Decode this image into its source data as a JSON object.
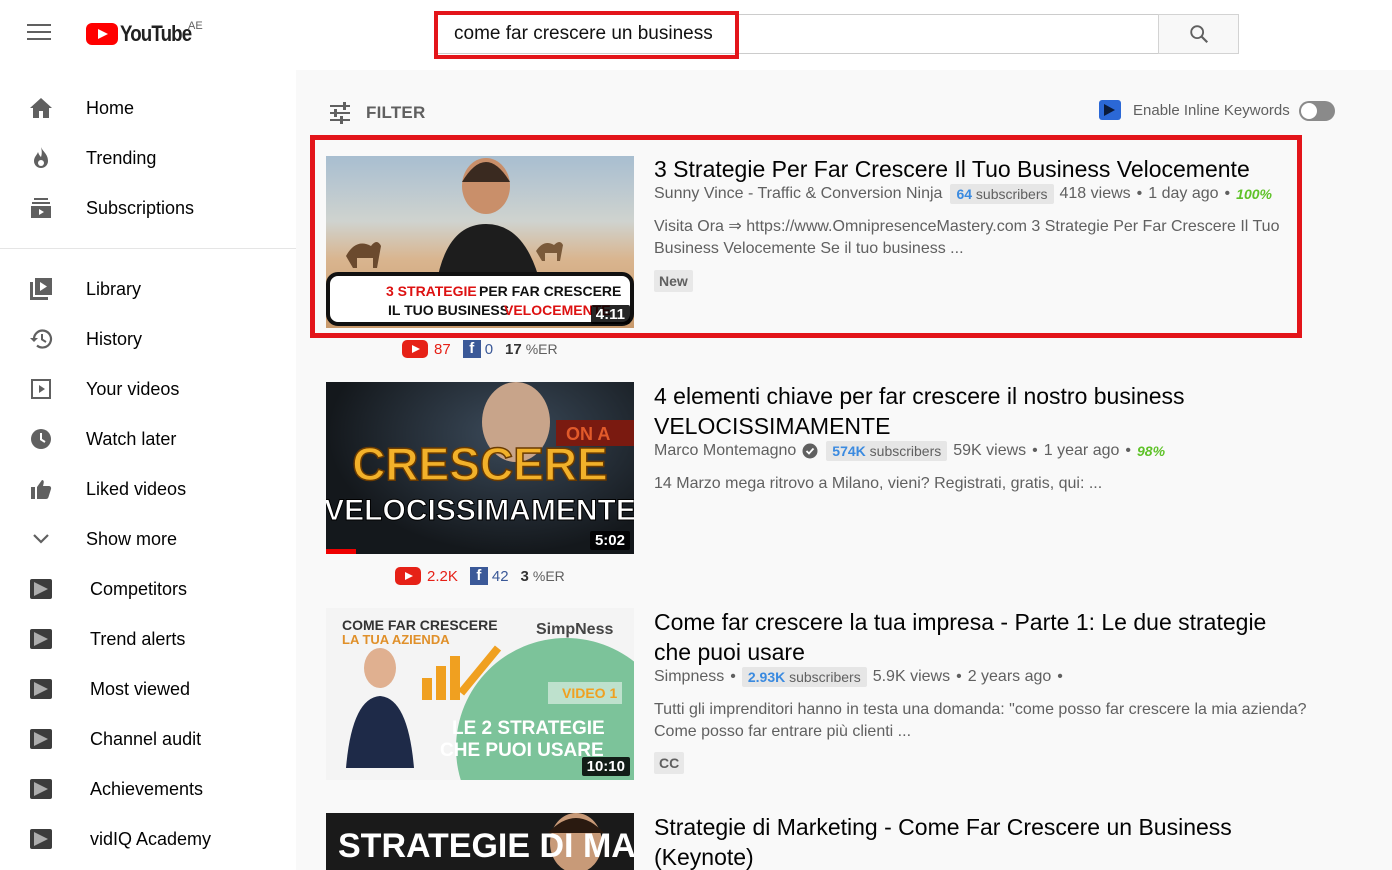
{
  "header": {
    "logo_text": "YouTube",
    "country": "AE",
    "search_value": "come far crescere un business"
  },
  "sidebar": {
    "main": [
      {
        "label": "Home",
        "icon": "home-icon"
      },
      {
        "label": "Trending",
        "icon": "trending-icon"
      },
      {
        "label": "Subscriptions",
        "icon": "subscriptions-icon"
      }
    ],
    "library": [
      {
        "label": "Library",
        "icon": "library-icon"
      },
      {
        "label": "History",
        "icon": "history-icon"
      },
      {
        "label": "Your videos",
        "icon": "your-videos-icon"
      },
      {
        "label": "Watch later",
        "icon": "watch-later-icon"
      },
      {
        "label": "Liked videos",
        "icon": "liked-videos-icon"
      },
      {
        "label": "Show more",
        "icon": "chevron-down-icon"
      }
    ],
    "vidiq": [
      {
        "label": "Competitors"
      },
      {
        "label": "Trend alerts"
      },
      {
        "label": "Most viewed"
      },
      {
        "label": "Channel audit"
      },
      {
        "label": "Achievements"
      },
      {
        "label": "vidIQ Academy"
      }
    ]
  },
  "toolbar": {
    "filter_label": "FILTER",
    "inline_keywords_label": "Enable Inline Keywords",
    "inline_keywords_enabled": false
  },
  "results": [
    {
      "title": "3 Strategie Per Far Crescere Il Tuo Business Velocemente",
      "channel": "Sunny Vince - Traffic & Conversion Ninja",
      "subs_count": "64",
      "subs_label": "subscribers",
      "views": "418 views",
      "age": "1 day ago",
      "score": "100%",
      "description": "Visita Ora ⇒ https://www.OmnipresenceMastery.com 3 Strategie Per Far Crescere Il Tuo Business Velocemente Se il tuo business ...",
      "badge": "New",
      "duration": "4:11",
      "thumb_line1a": "3 STRATEGIE",
      "thumb_line1b": " PER FAR CRESCERE",
      "thumb_line2a": "IL TUO BUSINESS ",
      "thumb_line2b": "VELOCEMENTE",
      "yt_count": "87",
      "fb_count": "0",
      "er": "17",
      "er_label": "%ER"
    },
    {
      "title": "4 elementi chiave per far crescere il nostro business VELOCISSIMAMENTE",
      "channel": "Marco Montemagno",
      "subs_count": "574K",
      "subs_label": "subscribers",
      "views": "59K views",
      "age": "1 year ago",
      "score": "98%",
      "description": "14 Marzo mega ritrovo a Milano, vieni? Registrati, gratis, qui: ...",
      "duration": "5:02",
      "thumb_word1": "CRESCERE",
      "thumb_word2": "VELOCISSIMAMENTE",
      "yt_count": "2.2K",
      "fb_count": "42",
      "er": "3",
      "er_label": "%ER"
    },
    {
      "title": "Come far crescere la tua impresa - Parte 1: Le due strategie che puoi usare",
      "channel": "Simpness",
      "subs_count": "2.93K",
      "subs_label": "subscribers",
      "views": "5.9K views",
      "age": "2 years ago",
      "description": "Tutti gli imprenditori hanno in testa una domanda: \"come posso far crescere la mia azienda? Come posso far entrare più clienti ...",
      "badge": "CC",
      "duration": "10:10",
      "thumb_line1": "COME FAR CRESCERE",
      "thumb_line2": "LA TUA AZIENDA",
      "thumb_brand": "SimpNess",
      "thumb_video": "VIDEO 1",
      "thumb_strat1": "LE 2 STRATEGIE",
      "thumb_strat2": "CHE PUOI USARE"
    },
    {
      "title": "Strategie di Marketing - Come Far Crescere un Business (Keynote)",
      "thumb_text": "STRATEGIE DI MARKETING"
    }
  ]
}
